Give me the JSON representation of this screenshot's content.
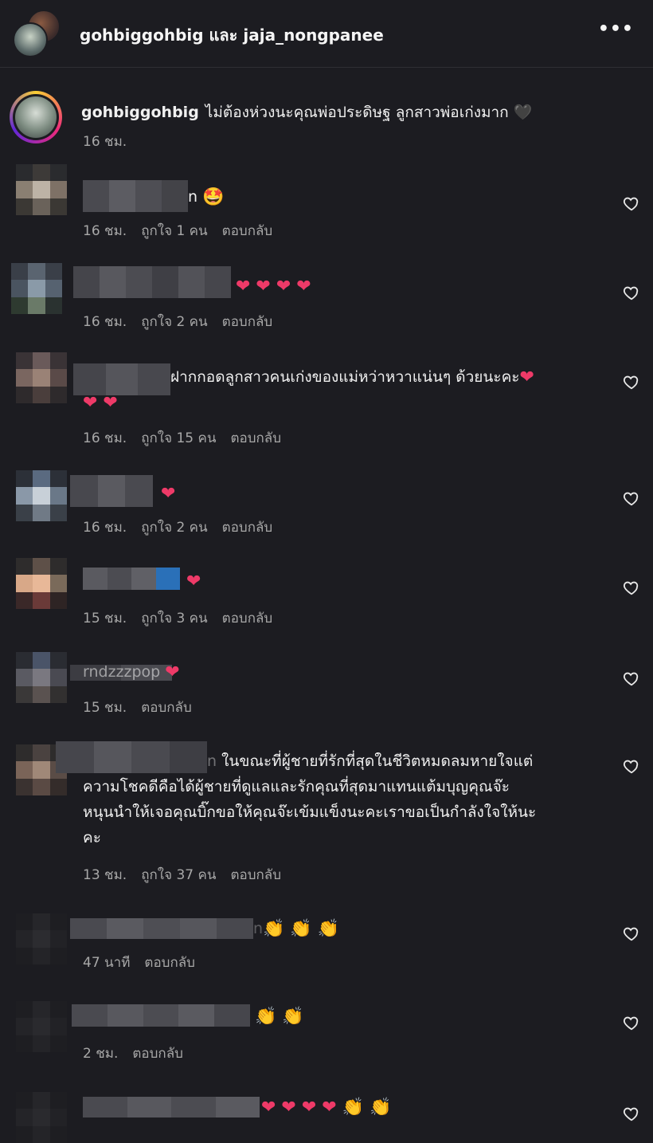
{
  "header": {
    "title": "gohbiggohbig และ jaja_nongpanee",
    "more_icon": "more-horizontal-icon"
  },
  "caption": {
    "username": "gohbiggohbig",
    "text": "ไม่ต้องห่วงนะคุณพ่อประดิษฐ ลูกสาวพ่อเก่งมาก",
    "emoji": "🖤",
    "time": "16 ชม."
  },
  "comments": [
    {
      "text": "n",
      "emoji": "🤩",
      "time": "16 ชม.",
      "likes": "ถูกใจ 1 คน",
      "reply": "ตอบกลับ"
    },
    {
      "text": "",
      "emoji": "❤ ❤ ❤ ❤",
      "time": "16 ชม.",
      "likes": "ถูกใจ 2 คน",
      "reply": "ตอบกลับ"
    },
    {
      "text": "ฝากกอดลูกสาวคนเก่งของแม่หว่าหวาแน่นๆ ด้วยนะคะ",
      "emoji": "❤",
      "emoji2": "❤ ❤",
      "time": "16 ชม.",
      "likes": "ถูกใจ 15 คน",
      "reply": "ตอบกลับ"
    },
    {
      "text": "",
      "emoji": "❤",
      "time": "16 ชม.",
      "likes": "ถูกใจ 2 คน",
      "reply": "ตอบกลับ"
    },
    {
      "text": "",
      "emoji": "❤",
      "time": "15 ชม.",
      "likes": "ถูกใจ 3 คน",
      "reply": "ตอบกลับ"
    },
    {
      "text": "rndzzzpop",
      "emoji": "❤",
      "time": "15 ชม.",
      "reply": "ตอบกลับ"
    },
    {
      "text_line1": "ในขณะที่ผู้ชายที่รักที่สุดในชีวิตหมดลมหายใจแต่",
      "text_line2": "ความโชคดีคือได้ผู้ชายที่ดูแลและรักคุณที่สุดมาแทนแต้มบุญคุณจ๊ะ",
      "text_line3": "หนุนนำให้เจอคุณบิ๊กขอให้คุณจ๊ะเข้มแข็งนะคะเราขอเป็นกำลังใจให้นะ",
      "text_line4": "คะ",
      "prefix": "n",
      "time": "13 ชม.",
      "likes": "ถูกใจ 37 คน",
      "reply": "ตอบกลับ"
    },
    {
      "text": "n",
      "emoji": "👏 👏 👏",
      "time": "47 นาที",
      "reply": "ตอบกลับ"
    },
    {
      "text": "",
      "emoji": "👏 👏",
      "time": "2 ชม.",
      "reply": "ตอบกลับ"
    },
    {
      "text": "",
      "emoji": "❤ ❤ ❤ ❤ 👏 👏"
    }
  ],
  "heart_icon": "heart-outline-icon",
  "colors": {
    "background": "#1c1c21",
    "text": "#f5f5f5",
    "muted": "#a8a8a8",
    "heart": "#ee3a68"
  }
}
